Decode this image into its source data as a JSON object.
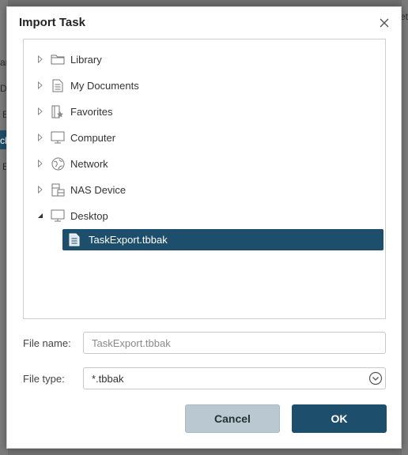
{
  "background": {
    "left_fragments": [
      "an",
      "Dis",
      "E",
      "ck",
      "E"
    ],
    "right_fragment": "et"
  },
  "dialog": {
    "title": "Import Task",
    "tree": [
      {
        "label": "Library",
        "icon": "folder-icon",
        "expanded": false
      },
      {
        "label": "My Documents",
        "icon": "document-icon",
        "expanded": false
      },
      {
        "label": "Favorites",
        "icon": "favorites-icon",
        "expanded": false
      },
      {
        "label": "Computer",
        "icon": "computer-icon",
        "expanded": false
      },
      {
        "label": "Network",
        "icon": "network-icon",
        "expanded": false
      },
      {
        "label": "NAS Device",
        "icon": "nas-icon",
        "expanded": false
      },
      {
        "label": "Desktop",
        "icon": "desktop-icon",
        "expanded": true
      }
    ],
    "selected_file": {
      "label": "TaskExport.tbbak",
      "icon": "file-icon"
    },
    "file_name": {
      "label": "File name:",
      "value": "TaskExport.tbbak"
    },
    "file_type": {
      "label": "File type:",
      "value": "*.tbbak"
    },
    "buttons": {
      "cancel": "Cancel",
      "ok": "OK"
    }
  },
  "colors": {
    "accent": "#1d4e6b",
    "cancel_bg": "#b9c8d1"
  }
}
